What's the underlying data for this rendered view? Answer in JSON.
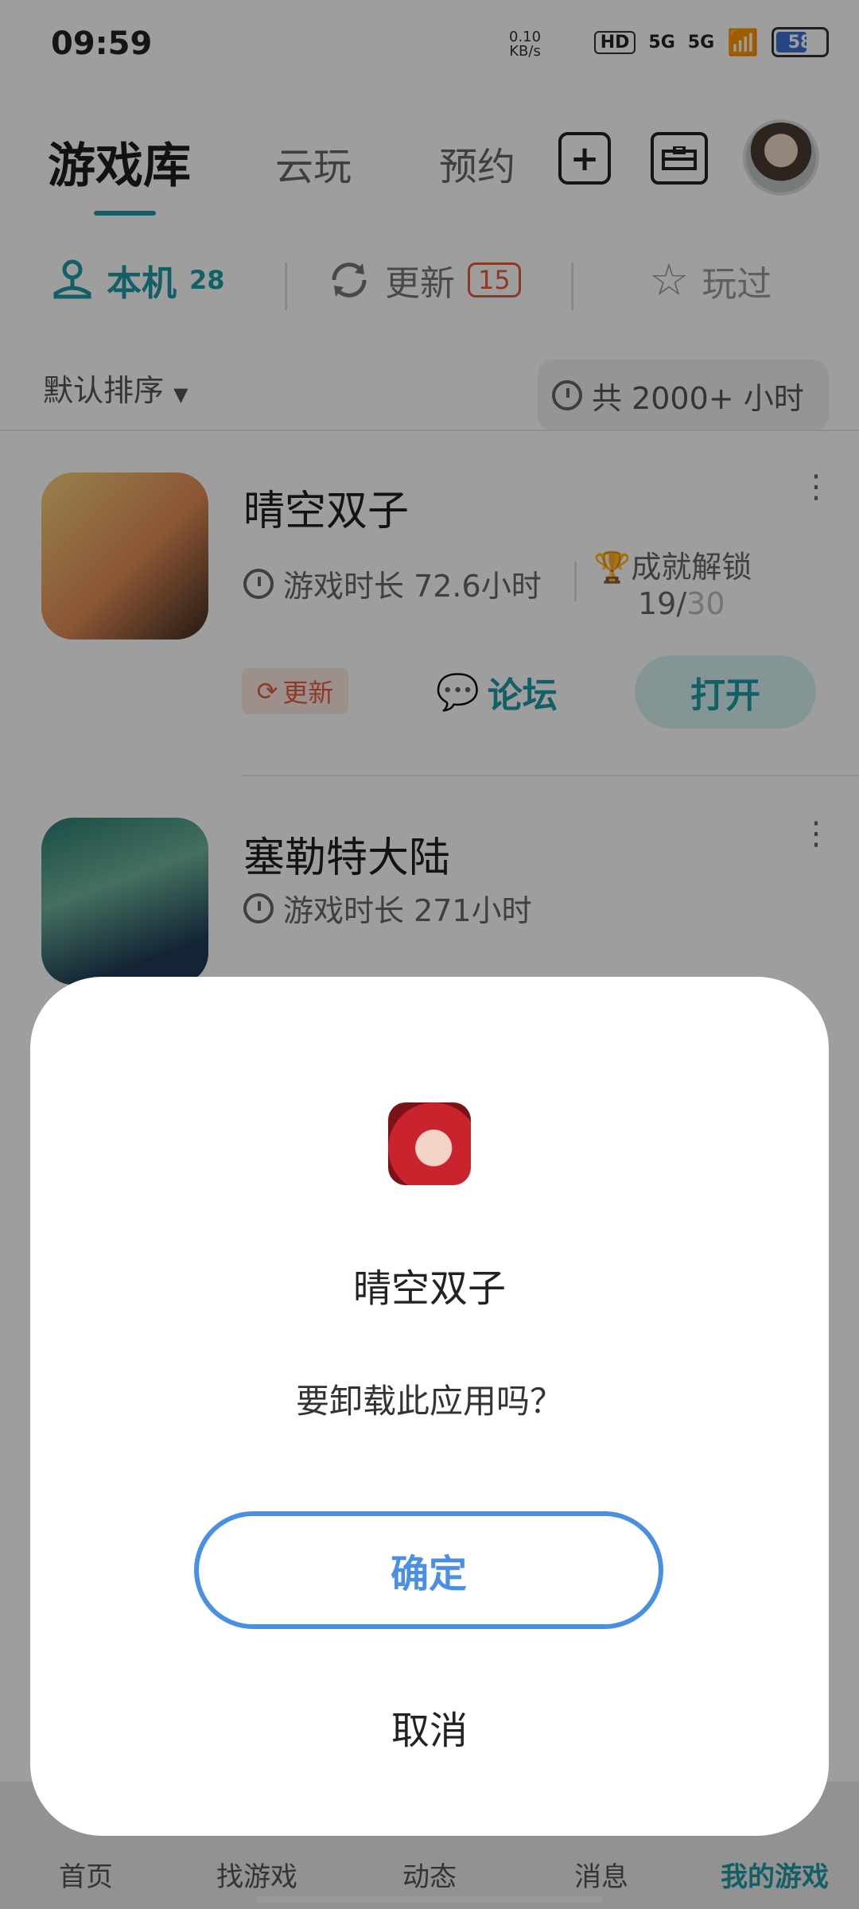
{
  "status_bar": {
    "time": "09:59",
    "net_speed": "0.10",
    "net_unit": "KB/s",
    "hd_label": "HD",
    "sim1": "5G",
    "sim2": "5G",
    "battery": "58"
  },
  "header": {
    "tabs": [
      "游戏库",
      "云玩",
      "预约"
    ],
    "active_tab": "游戏库",
    "add_icon": "plus-square-icon",
    "toolbox_icon": "briefcase-icon"
  },
  "filters": {
    "local_label": "本机",
    "local_count": "28",
    "update_label": "更新",
    "update_count": "15",
    "played_label": "玩过"
  },
  "sort_label": "默认排序",
  "total_playtime": "共 2000+ 小时",
  "games": [
    {
      "name": "晴空双子",
      "playtime": "游戏时长 72.6小时",
      "achievement_label": "成就解锁",
      "achievement_done": "19/",
      "achievement_total": "30",
      "update_chip": "更新",
      "forum": "论坛",
      "open": "打开"
    },
    {
      "name": "塞勒特大陆",
      "playtime": "游戏时长 271小时"
    }
  ],
  "bottom_nav": [
    "首页",
    "找游戏",
    "动态",
    "消息",
    "我的游戏"
  ],
  "bottom_nav_active": "我的游戏",
  "dialog": {
    "app_name": "晴空双子",
    "message": "要卸载此应用吗？",
    "confirm": "确定",
    "cancel": "取消"
  },
  "colors": {
    "accent": "#1e9aa5",
    "update": "#e35d3c",
    "confirm": "#4a90e2"
  }
}
